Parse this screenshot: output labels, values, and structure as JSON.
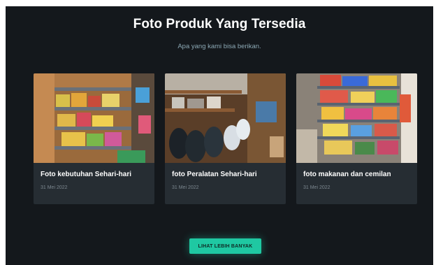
{
  "header": {
    "title": "Foto Produk Yang Tersedia",
    "subtitle": "Apa yang kami bisa berikan."
  },
  "cards": [
    {
      "title": "Foto kebutuhan Sehari-hari",
      "date": "31 Mei 2022"
    },
    {
      "title": "foto Peralatan Sehari-hari",
      "date": "31 Mei 2022"
    },
    {
      "title": "foto makanan dan cemilan",
      "date": "31 Mei 2022"
    }
  ],
  "button": {
    "label": "LIHAT LEBIH BANYAK"
  },
  "colors": {
    "background": "#14181c",
    "card": "#262d33",
    "accent": "#1fc8a2"
  }
}
